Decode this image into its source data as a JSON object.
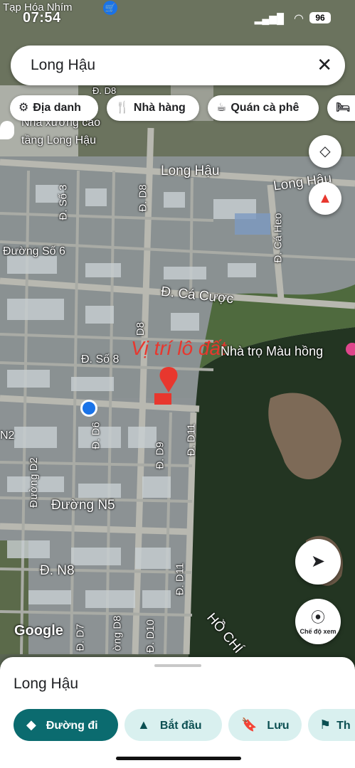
{
  "status_bar": {
    "carrier": "Tạp Hóa Nhím",
    "time": "07:54",
    "battery": "96"
  },
  "search": {
    "query": "Long Hậu"
  },
  "chips": [
    {
      "label": "Địa danh",
      "icon": "landmark-icon"
    },
    {
      "label": "Nhà hàng",
      "icon": "restaurant-icon"
    },
    {
      "label": "Quán cà phê",
      "icon": "coffee-icon"
    },
    {
      "label": "",
      "icon": "hotel-icon"
    }
  ],
  "map_labels": {
    "poi_factory_line1": "Nhà xưởng cao",
    "poi_factory_line2": "tầng Long Hậu",
    "long_hau_road_1": "Long Hậu",
    "long_hau_road_2": "Long Hậu",
    "d8_top": "Đ. D8",
    "d8_mid": "Đ. D8",
    "so3": "Đ. Số 3",
    "duong_so_6": "Đường Số 6",
    "ca_heo": "Đ. Cá Heo",
    "ca_cuoc": "Đ. Cá Cược",
    "d8_vertical": "D8",
    "so8": "Đ. Số 8",
    "annotation": "Vị trí lô đất",
    "nha_tro": "Nhà trọ Màu hồng",
    "d6": "Đ. D6",
    "d9": "Đ. D9",
    "d11": "Đ. D11",
    "d11_lower": "Đ. D11",
    "n2": "N2",
    "d2": "Đường D2",
    "n5": "Đường N5",
    "n8": "Đ. N8",
    "d7": "Đ. D7",
    "d8_lower": "ờng D8",
    "d10": "Đ. D10",
    "ho_chi": "HỒ CHÍ",
    "google": "Google"
  },
  "fab": {
    "street_view_label": "Chế độ xem"
  },
  "sheet": {
    "title": "Long Hậu",
    "buttons": [
      {
        "label": "Đường đi"
      },
      {
        "label": "Bắt đầu"
      },
      {
        "label": "Lưu"
      },
      {
        "label": "Th"
      }
    ]
  },
  "colors": {
    "primary_button": "#0b6b6f",
    "secondary_button": "#d9f0ef",
    "annotation_red": "#e8372e",
    "location_blue": "#1a73e8"
  }
}
